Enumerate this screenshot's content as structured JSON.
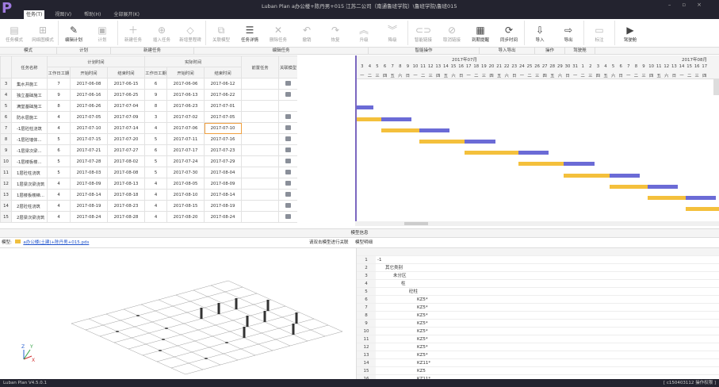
{
  "app": {
    "title": "Luban Plan a办公楼+陈丹男+015 江苏二公司（南通鲁班学院）\\鲁班学院\\鲁班015",
    "logo": "P",
    "window_controls": [
      "–",
      "▫",
      "×"
    ]
  },
  "tabs": [
    "任务(T)",
    "视图(V)",
    "帮助(H)",
    "全部展开(K)"
  ],
  "ribbon": {
    "buttons": [
      {
        "label": "任务模式",
        "icon": "task-mode-icon",
        "on": false
      },
      {
        "label": "网络图模式",
        "icon": "network-mode-icon",
        "on": false
      },
      {
        "label": "编辑计划",
        "icon": "edit-plan-icon",
        "on": true
      },
      {
        "label": "计划",
        "icon": "plan-icon",
        "on": false
      },
      {
        "label": "新建任务",
        "icon": "new-task-icon",
        "on": false
      },
      {
        "label": "插入任务",
        "icon": "insert-task-icon",
        "on": false
      },
      {
        "label": "新增里程碑",
        "icon": "milestone-icon",
        "on": false
      },
      {
        "label": "关联模型",
        "icon": "link-model-icon",
        "on": false
      },
      {
        "label": "任务详情",
        "icon": "task-detail-icon",
        "on": true
      },
      {
        "label": "删除任务",
        "icon": "delete-task-icon",
        "on": false
      },
      {
        "label": "撤销",
        "icon": "undo-icon",
        "on": false
      },
      {
        "label": "恢复",
        "icon": "redo-icon",
        "on": false
      },
      {
        "label": "升级",
        "icon": "upgrade-icon",
        "on": false
      },
      {
        "label": "降级",
        "icon": "downgrade-icon",
        "on": false
      },
      {
        "label": "智能链接",
        "icon": "smart-link-icon",
        "on": false
      },
      {
        "label": "取消链接",
        "icon": "unlink-icon",
        "on": false
      },
      {
        "label": "到期提醒",
        "icon": "reminder-icon",
        "on": true
      },
      {
        "label": "同步时间",
        "icon": "sync-icon",
        "on": true
      },
      {
        "label": "导入",
        "icon": "import-icon",
        "on": true
      },
      {
        "label": "导出",
        "icon": "export-icon",
        "on": true
      },
      {
        "label": "标注",
        "icon": "annotate-icon",
        "on": false
      },
      {
        "label": "驾驶舱",
        "icon": "play-icon",
        "on": true
      }
    ],
    "groups": [
      {
        "label": "模式",
        "w": 72
      },
      {
        "label": "计划",
        "w": 68
      },
      {
        "label": "新建任务",
        "w": 105
      },
      {
        "label": "编辑任务",
        "w": 220
      },
      {
        "label": "智能操作",
        "w": 140
      },
      {
        "label": "导入导出",
        "w": 70
      },
      {
        "label": "操作",
        "w": 38
      },
      {
        "label": "驾驶舱",
        "w": 38
      }
    ]
  },
  "grid": {
    "headers": {
      "name": "任务名称",
      "plan": "计划时间",
      "actual": "实际时间",
      "workdays": "工作日工期",
      "start": "开始时间",
      "end": "结束时间",
      "pred": "前置任务",
      "model": "关联模型"
    },
    "rows": [
      {
        "id": "3",
        "name": "集水井施工",
        "pd": "7",
        "ps": "2017-06-08",
        "pe": "2017-06-15",
        "ad": "6",
        "as": "2017-06-06",
        "ae": "2017-06-12",
        "model": true
      },
      {
        "id": "4",
        "name": "独立基础施工",
        "pd": "9",
        "ps": "2017-06-16",
        "pe": "2017-06-25",
        "ad": "9",
        "as": "2017-06-13",
        "ae": "2017-06-22",
        "model": true
      },
      {
        "id": "5",
        "name": "满堂基础施工",
        "pd": "8",
        "ps": "2017-06-26",
        "pe": "2017-07-04",
        "ad": "8",
        "as": "2017-06-23",
        "ae": "2017-07-01",
        "model": false
      },
      {
        "id": "6",
        "name": "防水层施工",
        "pd": "4",
        "ps": "2017-07-05",
        "pe": "2017-07-09",
        "ad": "3",
        "as": "2017-07-02",
        "ae": "2017-07-05",
        "model": true
      },
      {
        "id": "7",
        "name": "-1层砼柱浇筑",
        "pd": "4",
        "ps": "2017-07-10",
        "pe": "2017-07-14",
        "ad": "4",
        "as": "2017-07-06",
        "ae": "2017-07-10",
        "model": true,
        "sel": true
      },
      {
        "id": "8",
        "name": "-1层砼墙体...",
        "pd": "5",
        "ps": "2017-07-15",
        "pe": "2017-07-20",
        "ad": "5",
        "as": "2017-07-11",
        "ae": "2017-07-16",
        "model": true
      },
      {
        "id": "9",
        "name": "-1层梁次梁...",
        "pd": "6",
        "ps": "2017-07-21",
        "pe": "2017-07-27",
        "ad": "6",
        "as": "2017-07-17",
        "ae": "2017-07-23",
        "model": true
      },
      {
        "id": "10",
        "name": "-1层楼板楼...",
        "pd": "5",
        "ps": "2017-07-28",
        "pe": "2017-08-02",
        "ad": "5",
        "as": "2017-07-24",
        "ae": "2017-07-29",
        "model": true
      },
      {
        "id": "11",
        "name": "1层砼柱浇筑",
        "pd": "5",
        "ps": "2017-08-03",
        "pe": "2017-08-08",
        "ad": "5",
        "as": "2017-07-30",
        "ae": "2017-08-04",
        "model": true
      },
      {
        "id": "12",
        "name": "1层梁次梁浇筑",
        "pd": "4",
        "ps": "2017-08-09",
        "pe": "2017-08-13",
        "ad": "4",
        "as": "2017-08-05",
        "ae": "2017-08-09",
        "model": true
      },
      {
        "id": "13",
        "name": "1层楼板楼梯...",
        "pd": "4",
        "ps": "2017-08-14",
        "pe": "2017-08-18",
        "ad": "4",
        "as": "2017-08-10",
        "ae": "2017-08-14",
        "model": true
      },
      {
        "id": "14",
        "name": "2层砼柱浇筑",
        "pd": "4",
        "ps": "2017-08-19",
        "pe": "2017-08-23",
        "ad": "4",
        "as": "2017-08-15",
        "ae": "2017-08-19",
        "model": true
      },
      {
        "id": "15",
        "name": "2层梁次梁浇筑",
        "pd": "4",
        "ps": "2017-08-24",
        "pe": "2017-08-28",
        "ad": "4",
        "as": "2017-08-20",
        "ae": "2017-08-24",
        "model": true
      }
    ]
  },
  "gantt": {
    "months": [
      "2017年07月",
      "2017年08月"
    ],
    "start_date": "2017-07-03",
    "days": 46,
    "weekdays": [
      "一",
      "二",
      "三",
      "四",
      "五",
      "六",
      "日"
    ],
    "colors": {
      "actual": "#f4c03c",
      "plan": "#6b6bd6"
    }
  },
  "info": {
    "title": "模型信息",
    "model_label": "模型:",
    "model_file": "a办公楼(土建)+陈丹男+015.pds",
    "hint": "请双击模型进行关联",
    "detail_label": "模型明细"
  },
  "tree": [
    {
      "n": "1",
      "t": "-1",
      "lv": 0
    },
    {
      "n": "2",
      "t": "其它类别",
      "lv": 1
    },
    {
      "n": "3",
      "t": "未分区",
      "lv": 2
    },
    {
      "n": "4",
      "t": "柱",
      "lv": 3
    },
    {
      "n": "5",
      "t": "砼柱",
      "lv": 4
    },
    {
      "n": "6",
      "t": "KZ5*",
      "lv": 5
    },
    {
      "n": "7",
      "t": "KZ5*",
      "lv": 5
    },
    {
      "n": "8",
      "t": "KZ5*",
      "lv": 5
    },
    {
      "n": "9",
      "t": "KZ5*",
      "lv": 5
    },
    {
      "n": "10",
      "t": "KZ5*",
      "lv": 5
    },
    {
      "n": "11",
      "t": "KZ5*",
      "lv": 5
    },
    {
      "n": "12",
      "t": "KZ5*",
      "lv": 5
    },
    {
      "n": "13",
      "t": "KZ5*",
      "lv": 5
    },
    {
      "n": "14",
      "t": "KZ11*",
      "lv": 5
    },
    {
      "n": "15",
      "t": "KZ5",
      "lv": 5
    },
    {
      "n": "16",
      "t": "KZ11*",
      "lv": 5
    }
  ],
  "status": {
    "version": "Luban Plan V4.5.0.1",
    "user": "[ c150403112 操作权限 ]"
  }
}
